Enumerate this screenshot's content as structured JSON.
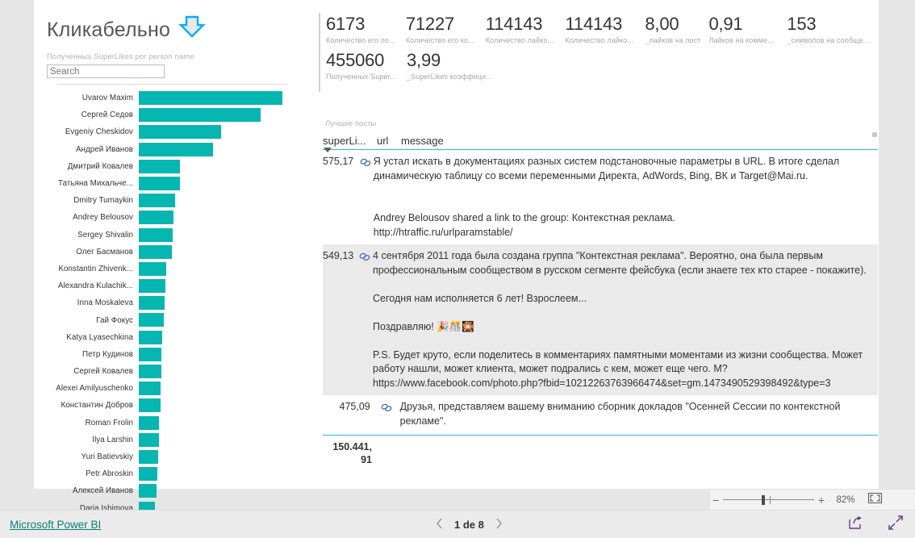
{
  "report": {
    "title": "Кликабельно",
    "arrow_icon": "down-arrow-icon"
  },
  "slicer": {
    "caption": "Полученных SuperLikes por person name",
    "search_placeholder": "Search",
    "search_value": ""
  },
  "chart_data": {
    "type": "bar",
    "title": "Полученных SuperLikes por person name",
    "orientation": "horizontal",
    "xlabel": "",
    "ylabel": "",
    "color": "#05b6b1",
    "categories": [
      "Uvarov Maxim",
      "Сергей Седов",
      "Evgeniy Cheskidov",
      "Андрей Иванов",
      "Дмитрий Ковалев",
      "Татьяна Михальче...",
      "Dmitry Tumaykin",
      "Andrey Belousov",
      "Sergey Shivalin",
      "Олег Басманов",
      "Konstantin Zhivenk...",
      "Alexandra Kulachik...",
      "Inna Moskaleva",
      "Гай Фокус",
      "Katya Lyasechkina",
      "Петр Кудинов",
      "Сергей Ковалев",
      "Alexei Amilyuschenko",
      "Константин Добров",
      "Roman Frolin",
      "Ilya Larshin",
      "Yuri Batievskiy",
      "Petr Abroskin",
      "Алексей Иванов",
      "Daria Ishimova"
    ],
    "values": [
      175,
      148,
      100,
      90,
      50,
      50,
      44,
      42,
      41,
      40,
      33,
      32,
      31,
      30,
      29,
      28,
      28,
      27,
      27,
      25,
      25,
      24,
      23,
      22,
      20
    ],
    "max_value": 175
  },
  "kpis": [
    {
      "value": "6173",
      "label": "Количество его по..."
    },
    {
      "value": "71227",
      "label": "Количество его ко..."
    },
    {
      "value": "114143",
      "label": "Количество лайко..."
    },
    {
      "value": "114143",
      "label": "Количество лайко..."
    },
    {
      "value": "8,00",
      "label": "_лайков на пост"
    },
    {
      "value": "0,91",
      "label": "Лайков на комме..."
    },
    {
      "value": "153",
      "label": "_символов на сообще..."
    },
    {
      "value": "455060",
      "label": "Полученных Super..."
    },
    {
      "value": "3,99",
      "label": "_SuperLikes коэффици..."
    }
  ],
  "table": {
    "caption": "Лучшие посты",
    "columns": [
      "superLi...",
      "url",
      "message"
    ],
    "sort_column": "superLi...",
    "sort_direction": "desc",
    "link_icon": "link-icon",
    "rows": [
      {
        "superlikes": "575,17",
        "url_icon": "link-icon",
        "message": "Я устал искать в документациях разных систем подстановочные параметры в URL. В итоге сделал динамическую таблицу со всеми переменными Директа, AdWords, Bing, ВК и Target@Mai.ru.\n\n\nAndrey Belousov shared a link to the group: Контекстная реклама.\nhttp://htraffic.ru/urlparamstable/",
        "highlighted": false
      },
      {
        "superlikes": "549,13",
        "url_icon": "link-icon",
        "message": "4 сентября 2011 года была создана группа \"Контекстная реклама\". Вероятно, она была первым профессиональным сообществом в русском сегменте фейсбука (если знаете тех кто старее - покажите).\n\nСегодня нам исполняется 6 лет! Взрослеем...\n\nПоздравляю! 🎉🎊🎇\n\nP.S. Будет круто, если поделитесь в комментариях памятными моментами из жизни сообщества. Может работу нашли, может клиента, может подрались с кем, может еще чего. М?\nhttps://www.facebook.com/photo.php?fbid=10212263763966474&set=gm.1473490529398492&type=3",
        "highlighted": true
      },
      {
        "superlikes": "475,09",
        "url_icon": "link-icon",
        "message": "Друзья, представляем вашему вниманию сборник докладов \"Осенней Сессии по контекстной рекламе\".",
        "highlighted": false
      }
    ],
    "total": "150.441,\n91"
  },
  "zoombar": {
    "minus": "−",
    "plus": "+",
    "percent": "82%",
    "fit_icon": "fit-to-page-icon"
  },
  "footer": {
    "brand": "Microsoft Power BI",
    "prev_icon": "chevron-left-icon",
    "page_label": "1 de 8",
    "next_icon": "chevron-right-icon",
    "share_icon": "share-icon",
    "fullscreen_icon": "fullscreen-icon"
  }
}
